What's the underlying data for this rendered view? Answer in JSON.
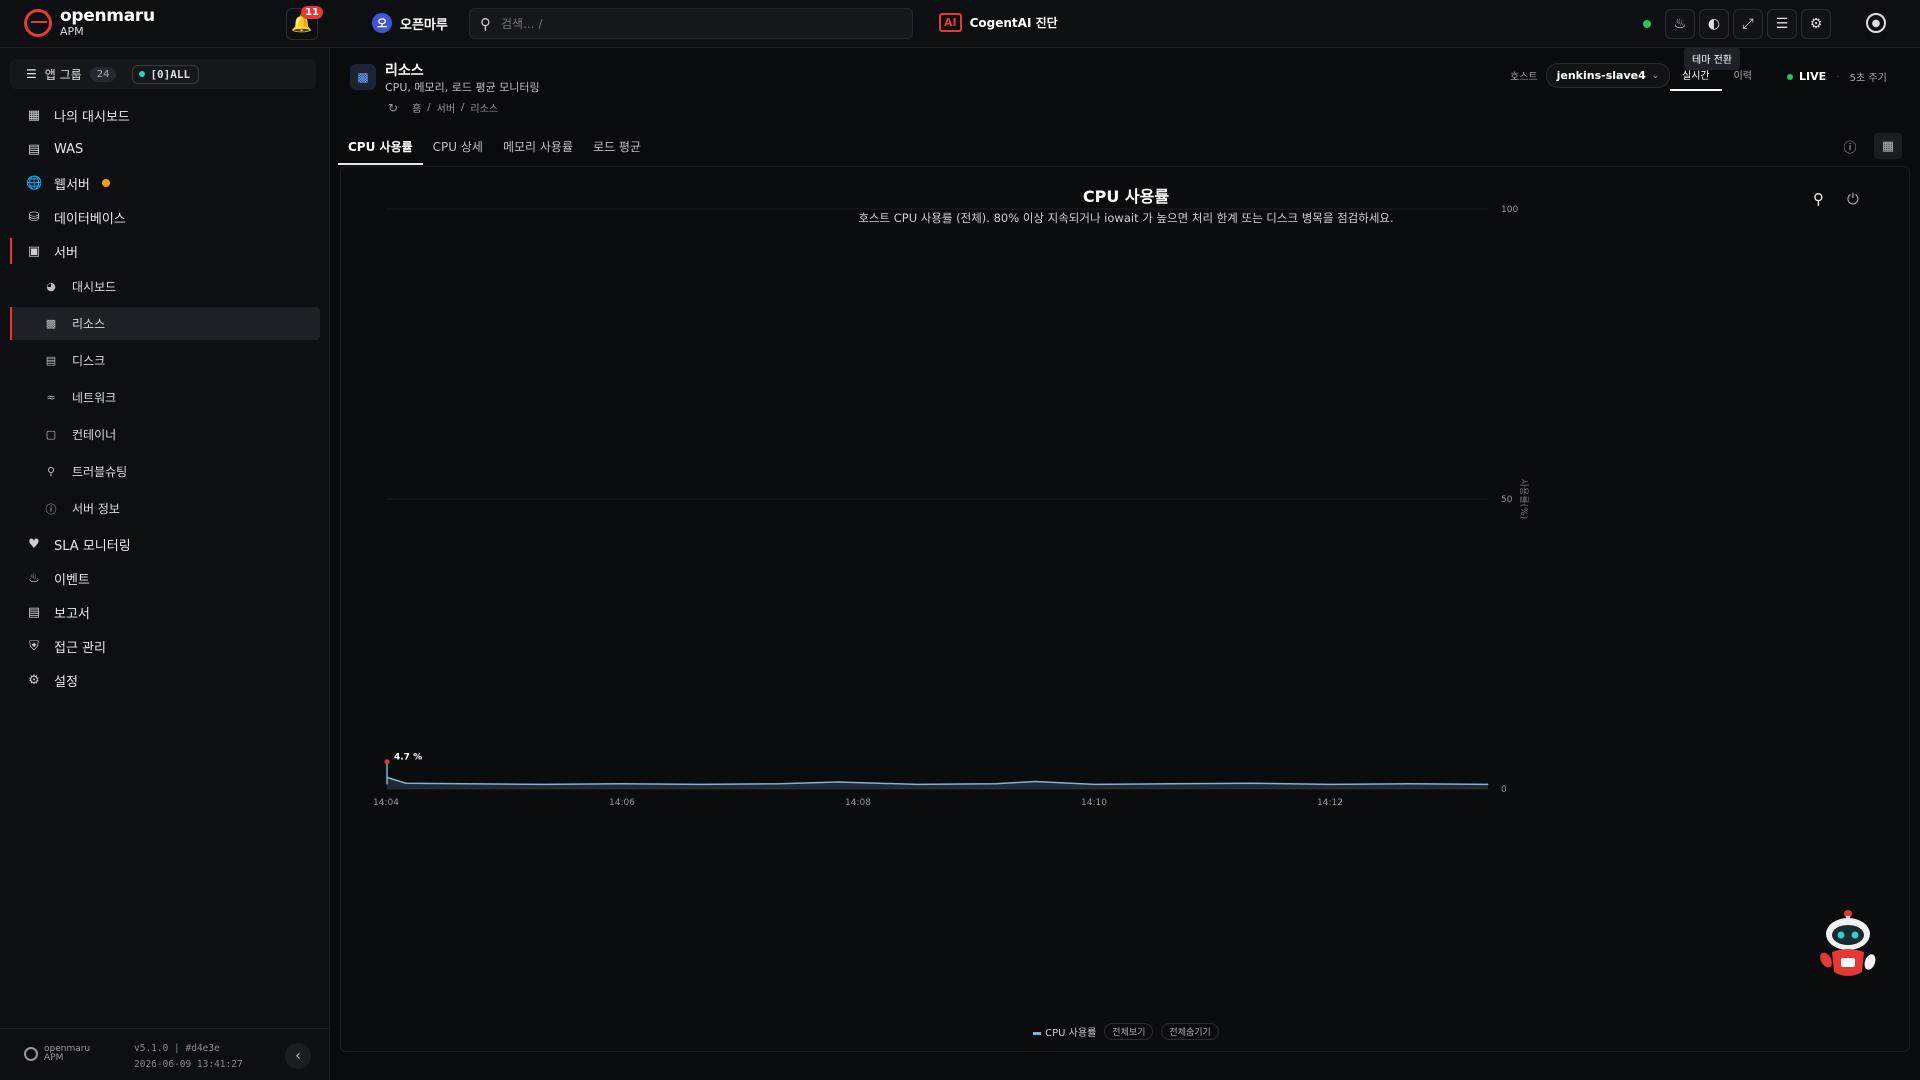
{
  "header": {
    "logo_main": "openmaru",
    "logo_sub": "APM",
    "notification_count": "11",
    "workspace_initial": "오",
    "workspace_name": "오픈마루",
    "search_placeholder": "검색... /",
    "ai_badge": "AI",
    "ai_label": "CogentAI 진단",
    "tooltip": "테마 전환"
  },
  "sidebar": {
    "app_group_label": "앱 그룹",
    "app_group_count": "24",
    "all_filter": "[0]ALL",
    "items": [
      {
        "label": "나의 대시보드",
        "icon": "grid-icon"
      },
      {
        "label": "WAS",
        "icon": "server-stack-icon"
      },
      {
        "label": "웹서버",
        "icon": "globe-icon"
      },
      {
        "label": "데이터베이스",
        "icon": "database-icon"
      },
      {
        "label": "서버",
        "icon": "monitor-icon"
      }
    ],
    "server_sub": [
      {
        "label": "대시보드",
        "icon": "gauge-icon"
      },
      {
        "label": "리소스",
        "icon": "chip-icon"
      },
      {
        "label": "디스크",
        "icon": "disk-icon"
      },
      {
        "label": "네트워크",
        "icon": "wifi-icon"
      },
      {
        "label": "컨테이너",
        "icon": "box-icon"
      },
      {
        "label": "트러블슈팅",
        "icon": "search-icon"
      },
      {
        "label": "서버 정보",
        "icon": "info-icon"
      }
    ],
    "items_after": [
      {
        "label": "SLA 모니터링",
        "icon": "heartbeat-icon"
      },
      {
        "label": "이벤트",
        "icon": "bell-icon"
      },
      {
        "label": "보고서",
        "icon": "bar-chart-icon"
      },
      {
        "label": "접근 관리",
        "icon": "shield-icon"
      },
      {
        "label": "설정",
        "icon": "gears-icon"
      }
    ],
    "footer_logo": "openmaru",
    "footer_logo_sub": "APM",
    "version": "v5.1.0 | #d4e3e",
    "build_time": "2026-06-09 13:41:27"
  },
  "page": {
    "title": "리소스",
    "subtitle": "CPU, 메모리, 로드 평균 모니터링",
    "breadcrumb": [
      "홈",
      "서버",
      "리소스"
    ],
    "host_label": "호스트",
    "host_value": "jenkins-slave4",
    "mode_tabs": [
      "실시간",
      "이력"
    ],
    "live_label": "LIVE",
    "period_label": "5초 주기",
    "tabs": [
      "CPU 사용률",
      "CPU 상세",
      "메모리 사용률",
      "로드 평균"
    ],
    "legend_btn_all_show": "전체보기",
    "legend_btn_all_hide": "전체숨기기"
  },
  "colors": {
    "accent": "#e53935",
    "live": "#22c55e",
    "series": "#7fb3d5"
  },
  "chart_data": {
    "type": "area",
    "title": "CPU 사용률",
    "subtitle": "호스트 CPU 사용률 (전체). 80% 이상 지속되거나 iowait 가 높으면 처리 한계 또는 디스크 병목을 점검하세요.",
    "ylabel": "사용률(%)",
    "ylim": [
      0,
      100
    ],
    "yticks": [
      0,
      50,
      100
    ],
    "xticks": [
      "14:04",
      "14:06",
      "14:08",
      "14:10",
      "14:12"
    ],
    "xlim_minutes": [
      13.33,
      14.26
    ],
    "grid": true,
    "legend_position": "bottom-center",
    "series": [
      {
        "name": "CPU 사용률",
        "peak_label": "4.7 %",
        "points": [
          [
            "13:03:30",
            0.9
          ],
          [
            "14:03:30",
            0.8
          ],
          [
            "14:03:40",
            1.0
          ],
          [
            "14:03:50",
            4.7
          ],
          [
            "14:04:00",
            2.0
          ],
          [
            "14:04:10",
            1.0
          ],
          [
            "14:04:40",
            0.9
          ],
          [
            "14:05:20",
            0.8
          ],
          [
            "14:06:00",
            0.9
          ],
          [
            "14:06:40",
            0.8
          ],
          [
            "14:07:20",
            0.9
          ],
          [
            "14:07:50",
            1.2
          ],
          [
            "14:08:30",
            0.8
          ],
          [
            "14:09:10",
            0.9
          ],
          [
            "14:09:30",
            1.3
          ],
          [
            "14:10:00",
            0.8
          ],
          [
            "14:10:40",
            0.9
          ],
          [
            "14:11:20",
            1.0
          ],
          [
            "14:12:00",
            0.8
          ],
          [
            "14:12:40",
            0.9
          ],
          [
            "14:13:20",
            0.8
          ],
          [
            "14:13:50",
            0.9
          ]
        ]
      }
    ]
  }
}
